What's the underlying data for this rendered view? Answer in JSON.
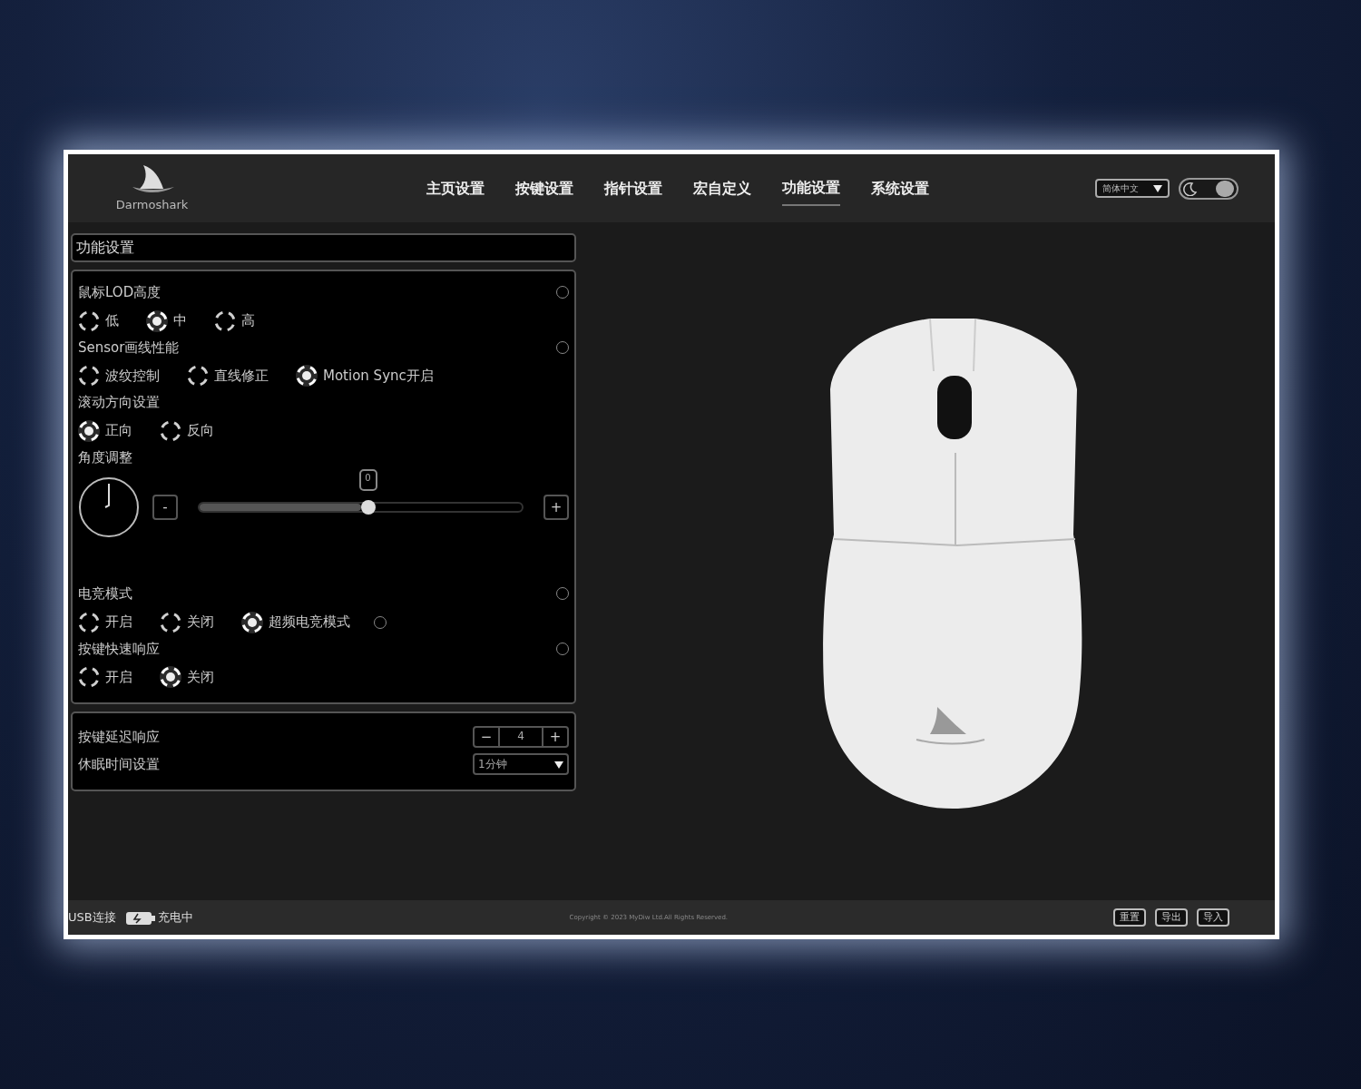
{
  "header": {
    "logo_text": "Darmoshark",
    "tabs": [
      {
        "label": "主页设置",
        "selected": false
      },
      {
        "label": "按键设置",
        "selected": false
      },
      {
        "label": "指针设置",
        "selected": false
      },
      {
        "label": "宏自定义",
        "selected": false
      },
      {
        "label": "功能设置",
        "selected": true
      },
      {
        "label": "系统设置",
        "selected": false
      }
    ],
    "language": "简体中文",
    "theme_toggle": {
      "on": true
    }
  },
  "section_title": "功能设置",
  "groups": [
    {
      "kind": "radio",
      "label": "鼠标LOD高度",
      "help": true,
      "options": [
        {
          "label": "低",
          "selected": false
        },
        {
          "label": "中",
          "selected": true
        },
        {
          "label": "高",
          "selected": false
        }
      ]
    },
    {
      "kind": "radio",
      "label": "Sensor画线性能",
      "help": true,
      "options": [
        {
          "label": "波纹控制",
          "selected": false
        },
        {
          "label": "直线修正",
          "selected": false
        },
        {
          "label": "Motion Sync开启",
          "selected": true
        }
      ]
    },
    {
      "kind": "radio",
      "label": "滚动方向设置",
      "help": false,
      "options": [
        {
          "label": "正向",
          "selected": true
        },
        {
          "label": "反向",
          "selected": false
        }
      ]
    },
    {
      "kind": "slider",
      "label": "角度调整",
      "help": false,
      "value": "0",
      "level": 0.5,
      "minus": "-",
      "plus": "+"
    },
    {
      "kind": "radio",
      "label": "电竞模式",
      "help": true,
      "options": [
        {
          "label": "开启",
          "selected": false
        },
        {
          "label": "关闭",
          "selected": false
        },
        {
          "label": "超频电竞模式",
          "selected": true,
          "help": true
        }
      ]
    },
    {
      "kind": "radio",
      "label": "按键快速响应",
      "help": true,
      "options": [
        {
          "label": "开启",
          "selected": false
        },
        {
          "label": "关闭",
          "selected": true
        }
      ]
    }
  ],
  "extras": [
    {
      "kind": "stepper",
      "label": "按键延迟响应",
      "value": "4",
      "minus": "−",
      "plus": "+"
    },
    {
      "kind": "select",
      "label": "休眠时间设置",
      "value": "1分钟"
    }
  ],
  "status_bar": {
    "connection": "USB连接",
    "charging": "充电中",
    "copyright": "Copyright © 2023 MyDiw Ltd.All Rights Reserved.",
    "buttons": [
      "重置",
      "导出",
      "导入"
    ]
  }
}
